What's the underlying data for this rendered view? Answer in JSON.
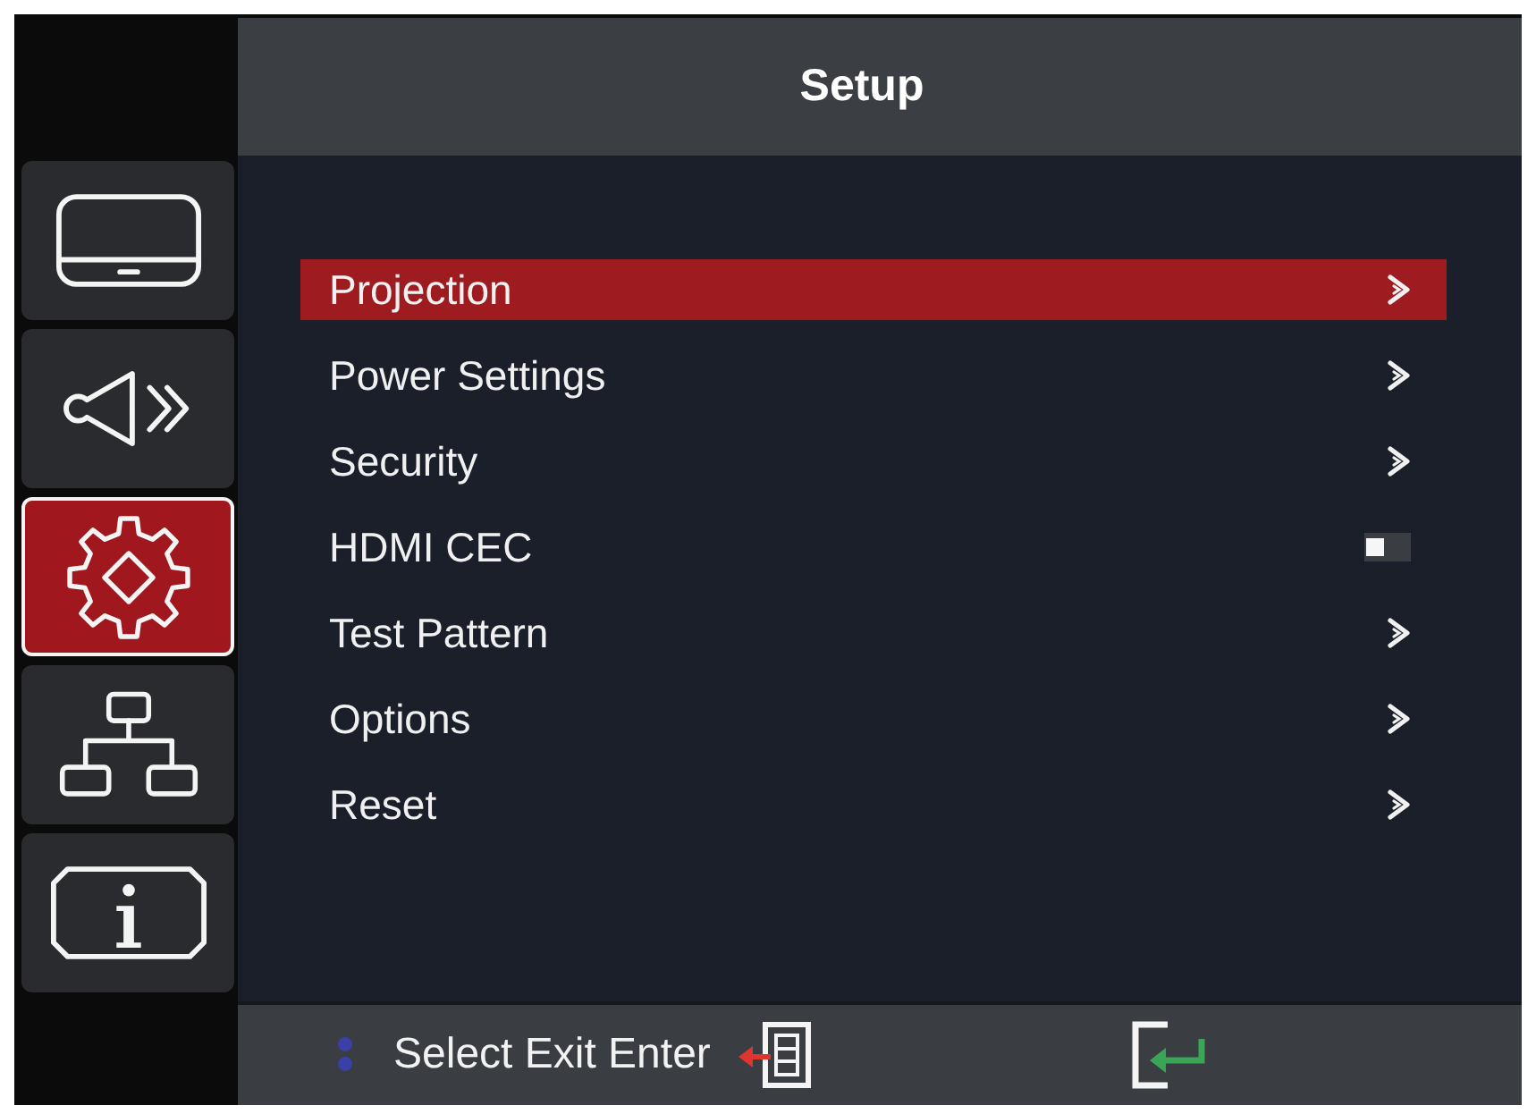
{
  "window": {
    "title": "Setup"
  },
  "sidebar": {
    "items": [
      {
        "kind": "display",
        "selected": false
      },
      {
        "kind": "audio",
        "selected": false
      },
      {
        "kind": "setup",
        "selected": true
      },
      {
        "kind": "network",
        "selected": false
      },
      {
        "kind": "info",
        "selected": false
      }
    ]
  },
  "menu": {
    "items": [
      {
        "label": "Projection",
        "kind": "submenu",
        "selected": true
      },
      {
        "label": "Power Settings",
        "kind": "submenu",
        "selected": false
      },
      {
        "label": "Security",
        "kind": "submenu",
        "selected": false
      },
      {
        "label": "HDMI CEC",
        "kind": "toggle",
        "on": false,
        "selected": false
      },
      {
        "label": "Test Pattern",
        "kind": "submenu",
        "selected": false
      },
      {
        "label": "Options",
        "kind": "submenu",
        "selected": false
      },
      {
        "label": "Reset",
        "kind": "submenu",
        "selected": false
      }
    ]
  },
  "footer": {
    "hint": "Select Exit Enter"
  }
}
